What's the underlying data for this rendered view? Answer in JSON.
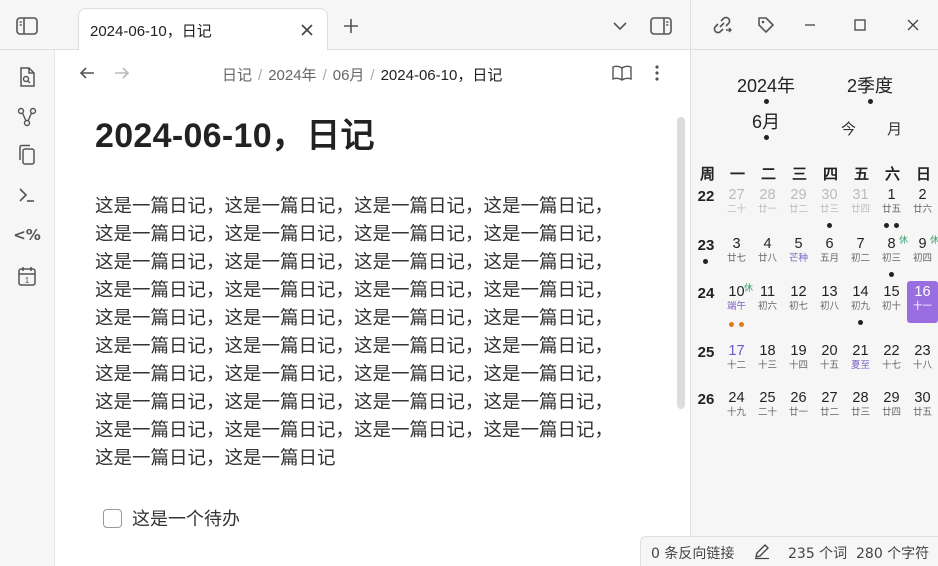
{
  "tab": {
    "title": "2024-06-10，日记"
  },
  "breadcrumb": {
    "items": [
      "日记",
      "2024年",
      "06月"
    ],
    "current": "2024-06-10，日记",
    "separator": "/"
  },
  "note": {
    "title": "2024-06-10，日记",
    "lines": [
      "这是一篇日记，这是一篇日记，这是一篇日记，这是一篇日记，",
      "这是一篇日记，这是一篇日记，这是一篇日记，这是一篇日记，",
      "这是一篇日记，这是一篇日记，这是一篇日记，这是一篇日记，",
      "这是一篇日记，这是一篇日记，这是一篇日记，这是一篇日记，",
      "这是一篇日记，这是一篇日记，这是一篇日记，这是一篇日记，",
      "这是一篇日记，这是一篇日记，这是一篇日记，这是一篇日记，",
      "这是一篇日记，这是一篇日记，这是一篇日记，这是一篇日记，",
      "这是一篇日记，这是一篇日记，这是一篇日记，这是一篇日记，",
      "这是一篇日记，这是一篇日记，这是一篇日记，这是一篇日记，",
      "这是一篇日记，这是一篇日记"
    ],
    "todo": {
      "label": "这是一个待办",
      "checked": false
    }
  },
  "ribbon": {
    "icons": [
      "switcher-icon",
      "graph-icon",
      "copy-icon",
      "terminal-icon",
      "templater-icon",
      "daily-note-icon"
    ]
  },
  "calendar": {
    "year": "2024年",
    "quarter": "2季度",
    "month": "6月",
    "today_label": "今",
    "month_label": "月",
    "weekdays": [
      "周",
      "一",
      "二",
      "三",
      "四",
      "五",
      "六",
      "日"
    ],
    "weeks": [
      {
        "week": "22",
        "days": [
          {
            "num": "27",
            "lunar": "二十",
            "other": true
          },
          {
            "num": "28",
            "lunar": "廿一",
            "other": true
          },
          {
            "num": "29",
            "lunar": "廿二",
            "other": true
          },
          {
            "num": "30",
            "lunar": "廿三",
            "other": true,
            "dots": 1
          },
          {
            "num": "31",
            "lunar": "廿四",
            "other": true
          },
          {
            "num": "1",
            "lunar": "廿五",
            "dots": 2
          },
          {
            "num": "2",
            "lunar": "廿六"
          }
        ]
      },
      {
        "week": "23",
        "weekdot": true,
        "days": [
          {
            "num": "3",
            "lunar": "廿七"
          },
          {
            "num": "4",
            "lunar": "廿八"
          },
          {
            "num": "5",
            "lunar": "芒种",
            "term": true
          },
          {
            "num": "6",
            "lunar": "五月"
          },
          {
            "num": "7",
            "lunar": "初二"
          },
          {
            "num": "8",
            "lunar": "初三",
            "holiday": "休",
            "dots": 1
          },
          {
            "num": "9",
            "lunar": "初四",
            "holiday": "休"
          }
        ]
      },
      {
        "week": "24",
        "days": [
          {
            "num": "10",
            "lunar": "端午",
            "holiday": "休",
            "festival": true,
            "orangedots": 1
          },
          {
            "num": "11",
            "lunar": "初六"
          },
          {
            "num": "12",
            "lunar": "初七"
          },
          {
            "num": "13",
            "lunar": "初八"
          },
          {
            "num": "14",
            "lunar": "初九",
            "dots": 1
          },
          {
            "num": "15",
            "lunar": "初十"
          },
          {
            "num": "16",
            "lunar": "十一",
            "today": true
          }
        ]
      },
      {
        "week": "25",
        "days": [
          {
            "num": "17",
            "lunar": "十二",
            "purple": true
          },
          {
            "num": "18",
            "lunar": "十三"
          },
          {
            "num": "19",
            "lunar": "十四"
          },
          {
            "num": "20",
            "lunar": "十五"
          },
          {
            "num": "21",
            "lunar": "夏至",
            "term": true
          },
          {
            "num": "22",
            "lunar": "十七"
          },
          {
            "num": "23",
            "lunar": "十八"
          }
        ]
      },
      {
        "week": "26",
        "days": [
          {
            "num": "24",
            "lunar": "十九"
          },
          {
            "num": "25",
            "lunar": "二十"
          },
          {
            "num": "26",
            "lunar": "廿一"
          },
          {
            "num": "27",
            "lunar": "廿二"
          },
          {
            "num": "28",
            "lunar": "廿三"
          },
          {
            "num": "29",
            "lunar": "廿四"
          },
          {
            "num": "30",
            "lunar": "廿五"
          }
        ]
      }
    ]
  },
  "status": {
    "backlinks": "0 条反向链接",
    "words": "235 个词",
    "chars": "280 个字符"
  },
  "colors": {
    "accent": "#9a6ee0",
    "holiday": "#35a06b",
    "term": "#7b5fc4",
    "event_dot": "#e07b1a"
  }
}
